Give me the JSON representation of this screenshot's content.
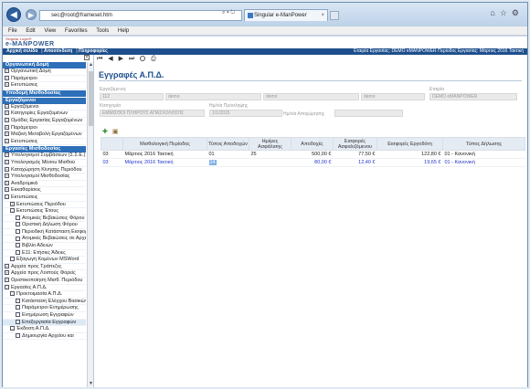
{
  "browser": {
    "address": "sec@root@frameset.htm",
    "tab_title": "Singular e-ManPower",
    "menu": [
      "File",
      "Edit",
      "View",
      "Favorites",
      "Tools",
      "Help"
    ]
  },
  "app": {
    "logo_small": "Singular Logic®",
    "logo_brand": "e-MANPOWER",
    "topnav_links": [
      "Αρχική σελίδα",
      "Αποσύνδεση",
      "Πληροφορίες"
    ],
    "topnav_status": "Εταιρία Εργασίας: DEMO eMANPOWER   Περίοδος Εργασίας: Μάρτιος 2016 Τακτική"
  },
  "sidebar": {
    "sections": [
      {
        "header": "Οργανωτική Δομή",
        "items": [
          {
            "label": "Οργανωτική Δομή",
            "mark": "+"
          },
          {
            "label": "Παράμετροι",
            "mark": "+"
          },
          {
            "label": "Εκτυπώσεις",
            "mark": "+"
          }
        ]
      },
      {
        "header": "Υποδομή Μισθοδοσίας",
        "items": []
      },
      {
        "header": "Εργαζόμενοι",
        "items": [
          {
            "label": "Εργαζόμενοι",
            "mark": "+"
          },
          {
            "label": "Κατηγορίες Εργαζομένων",
            "mark": "+"
          },
          {
            "label": "Ομάδες Εργασίας Εργαζομένων",
            "mark": "+"
          },
          {
            "label": "Παράμετροι",
            "mark": "+"
          },
          {
            "label": "Μαζική Μεταβολή Εργαζομένων",
            "mark": "+"
          },
          {
            "label": "Εκτυπώσεις",
            "mark": "+"
          }
        ]
      },
      {
        "header": "Εργασίες Μισθοδοσίας",
        "items": [
          {
            "label": "Υπολογισμοί Συμβάσεων (Σ.Σ.Ε.)",
            "mark": "+"
          },
          {
            "label": "Υπολογισμός Μέσου Μισθού",
            "mark": "+"
          },
          {
            "label": "Καταχώρηση Κίνησης Περιόδου",
            "mark": "+"
          },
          {
            "label": "Υπολογισμοί Μισθοδοσίας",
            "mark": "+"
          },
          {
            "label": "Αναδρομικά",
            "mark": "+"
          },
          {
            "label": "Εκκαθαρίσεις",
            "mark": "+"
          },
          {
            "label": "Εκτυπώσεις",
            "mark": "-"
          },
          {
            "label": "Εκτυπώσεις Περιόδου",
            "mark": "+",
            "indent": 1
          },
          {
            "label": "Εκτυπώσεις Έτους",
            "mark": "-",
            "indent": 1
          },
          {
            "label": "Ατομικές Βεβαιώσεις Φόρου",
            "mark": "",
            "indent": 2
          },
          {
            "label": "Οριστική Δήλωση Φόρου",
            "mark": "",
            "indent": 2
          },
          {
            "label": "Περιοδική Κατάσταση Εισφορών",
            "mark": "",
            "indent": 2
          },
          {
            "label": "Ατομικές Βεβαιώσεις σε Αρχείο",
            "mark": "",
            "indent": 2
          },
          {
            "label": "Βιβλίο Αδειών",
            "mark": "",
            "indent": 2
          },
          {
            "label": "Ε11: Ετήσιες Άδειες",
            "mark": "",
            "indent": 2
          },
          {
            "label": "Εξαγωγή Κομένων MSWord",
            "mark": "",
            "indent": 1
          },
          {
            "label": "Αρχεία προς Τράπεζες",
            "mark": "+"
          },
          {
            "label": "Αρχεία προς Λοιπούς Φορείς",
            "mark": "+"
          },
          {
            "label": "Οριστικοποίηση Μισθ. Περιόδου",
            "mark": "+"
          },
          {
            "label": "Εργασίες Α.Π.Δ.",
            "mark": "-"
          },
          {
            "label": "Προετοιμασία Α.Π.Δ.",
            "mark": "-",
            "indent": 1
          },
          {
            "label": "Κατάσταση Ελέγχου Βασικών",
            "mark": "",
            "indent": 2
          },
          {
            "label": "Παράμετροι Ενημέρωσης",
            "mark": "",
            "indent": 2
          },
          {
            "label": "Ενημέρωση Εγγραφών",
            "mark": "",
            "indent": 2
          },
          {
            "label": "Επεξεργασία Εγγραφών",
            "mark": "",
            "indent": 2,
            "selected": true
          },
          {
            "label": "Έκδοση Α.Π.Δ.",
            "mark": "-",
            "indent": 1
          },
          {
            "label": "Δημιουργία Αρχείου και",
            "mark": "",
            "indent": 2
          }
        ]
      }
    ]
  },
  "page": {
    "title": "Εγγραφές Α.Π.Δ.",
    "fields": {
      "employee_label": "Εργαζόμενος",
      "employee_code": "112",
      "employee_v1": "demo",
      "employee_v2": "demo",
      "employee_v3": "demo",
      "company_label": "Εταιρία",
      "company_value": "DEMO eMANPOWER",
      "category_label": "Κατηγορία",
      "category_value": "ΕΜΜΙΣΘΟΙ ΠΛΗΡΟΥΣ ΑΠΑΣΧΟΛΗΣΗΣ",
      "hire_date_label": "Ημ/νία Πρόσληψης",
      "hire_date_value": "1/1/2015",
      "leave_date_label": "Ημ/νία Αποχώρησης",
      "leave_date_value": ""
    }
  },
  "table": {
    "columns": [
      "Μισθολογική Περίοδος",
      "Τύπος Αποδοχών",
      "Ημέρες Ασφάλισης",
      "Αποδοχές",
      "Εισφορές Ασφαλιζόμενου",
      "Εισφορές Εργοδότη",
      "Τύπος Δήλωσης"
    ],
    "rows": [
      {
        "c0": "03",
        "period": "Μάρτιος 2016 Τακτική",
        "type": "01",
        "days": "25",
        "earnings": "500,00 €",
        "ins": "77,50 €",
        "emp": "122,80 €",
        "decl": "01 - Κανονική"
      },
      {
        "c0": "03",
        "period": "Μάρτιος 2016 Τακτική",
        "type": "14",
        "days": "",
        "earnings": "80,00 €",
        "ins": "12,40 €",
        "emp": "19,65 €",
        "decl": "01 - Κανονική"
      }
    ]
  }
}
